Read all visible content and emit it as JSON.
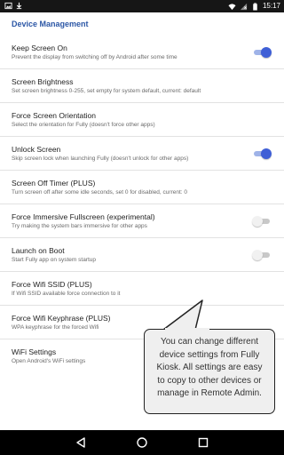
{
  "status_bar": {
    "time": "15:17",
    "left_icons": [
      "image-icon",
      "download-icon"
    ],
    "right_icons": [
      "wifi-icon",
      "no-sim-icon",
      "battery-icon"
    ]
  },
  "section": {
    "title": "Device Management"
  },
  "preferences": [
    {
      "title": "Keep Screen On",
      "summary": "Prevent the display from switching off by Android after some time",
      "switch": "on"
    },
    {
      "title": "Screen Brightness",
      "summary": "Set screen brightness 0-255, set empty for system default, current: default",
      "switch": null
    },
    {
      "title": "Force Screen Orientation",
      "summary": "Select the orientation for Fully (doesn't force other apps)",
      "switch": null
    },
    {
      "title": "Unlock Screen",
      "summary": "Skip screen lock when launching Fully (doesn't unlock for other apps)",
      "switch": "on"
    },
    {
      "title": "Screen Off Timer (PLUS)",
      "summary": "Turn screen off after some idle seconds, set 0 for disabled, current: 0",
      "switch": null
    },
    {
      "title": "Force Immersive Fullscreen (experimental)",
      "summary": "Try making the system bars immersive for other apps",
      "switch": "off"
    },
    {
      "title": "Launch on Boot",
      "summary": "Start Fully app on system startup",
      "switch": "off"
    },
    {
      "title": "Force Wifi SSID (PLUS)",
      "summary": "If Wifi SSID available force connection to it",
      "switch": null
    },
    {
      "title": "Force Wifi Keyphrase (PLUS)",
      "summary": "WPA keyphrase for the forced Wifi",
      "switch": null
    },
    {
      "title": "WiFi Settings",
      "summary": "Open Android's WiFi settings",
      "switch": null
    }
  ],
  "tooltip": {
    "text": "You can change different device settings from Fully Kiosk. All settings are easy to copy to other devices or manage in Remote Admin."
  },
  "nav_bar": {
    "buttons": [
      "back-icon",
      "home-icon",
      "recents-icon"
    ]
  },
  "colors": {
    "accent": "#3f5fd6",
    "section_title": "#2c57a6",
    "status_bar": "#161616",
    "nav_bar": "#000000"
  }
}
